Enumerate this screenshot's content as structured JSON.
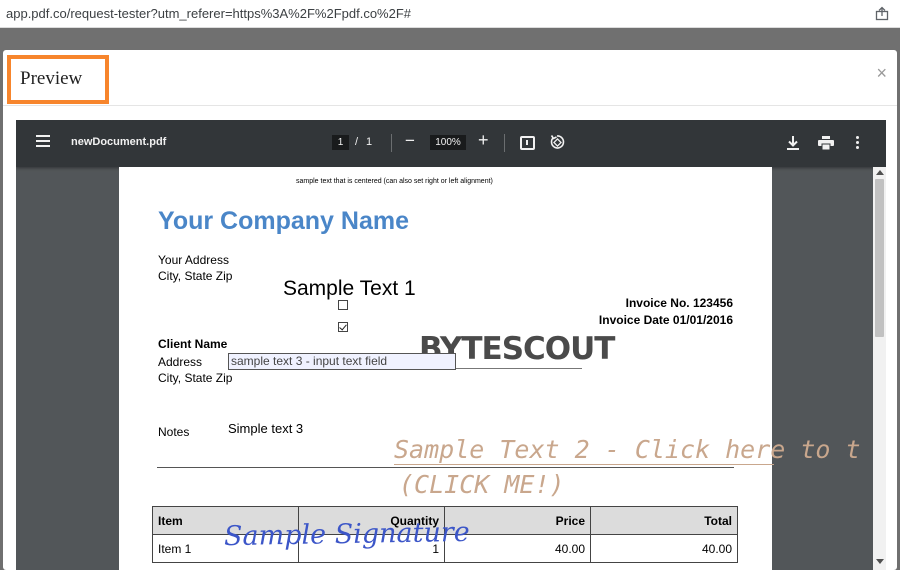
{
  "browser": {
    "url": "app.pdf.co/request-tester?utm_referer=https%3A%2F%2Fpdf.co%2F#",
    "share_icon": "share-icon"
  },
  "modal": {
    "title": "Preview",
    "close_label": "×"
  },
  "viewer": {
    "filename": "newDocument.pdf",
    "current_page": "1",
    "page_separator": "/",
    "total_pages": "1",
    "zoom": "100%",
    "zoom_out": "−",
    "zoom_in": "+",
    "icons": [
      "menu-icon",
      "fit-page-icon",
      "rotate-icon",
      "download-icon",
      "print-icon",
      "more-vert-icon"
    ]
  },
  "document": {
    "centered_note": "sample text that is centered (can also set right or left alignment)",
    "company_name": "Your Company Name",
    "address_line1": "Your Address",
    "address_line2": "City, State Zip",
    "sample_text_1": "Sample Text 1",
    "checkbox1_checked": false,
    "checkbox2_checked": true,
    "invoice_no": "Invoice No. 123456",
    "invoice_date": "Invoice Date 01/01/2016",
    "client_name": "Client Name",
    "client_address": "Address",
    "client_city": "City, State Zip",
    "input_field_value": "sample text 3 - input text field",
    "logo_text": "BYTESCOUT",
    "notes_label": "Notes",
    "simple_text_3": "Simple text 3",
    "sample_text_2_line1": "Sample Text 2 - Click here to t",
    "sample_text_2_line2": "(CLICK ME!)",
    "signature": "Sample Signature",
    "table": {
      "headers": [
        "Item",
        "Quantity",
        "Price",
        "Total"
      ],
      "rows": [
        [
          "Item 1",
          "1",
          "40.00",
          "40.00"
        ]
      ]
    }
  }
}
